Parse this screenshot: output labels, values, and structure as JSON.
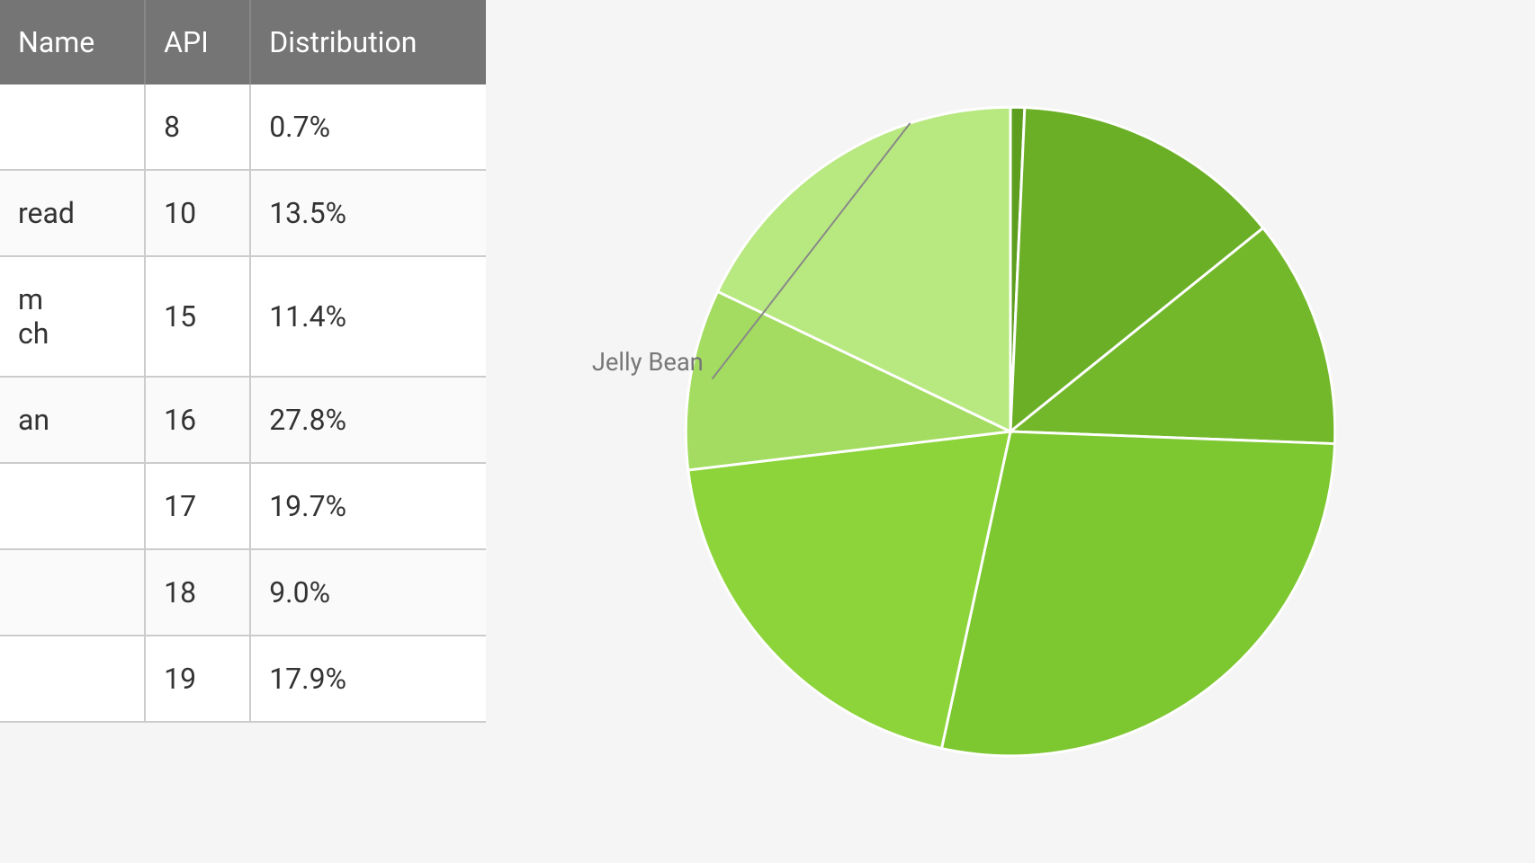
{
  "table": {
    "headers": [
      "Name",
      "API",
      "Distribution"
    ],
    "rows": [
      {
        "name": "",
        "api": "8",
        "distribution": "0.7%"
      },
      {
        "name": "read",
        "api": "10",
        "distribution": "13.5%"
      },
      {
        "name": "m\nch",
        "api": "15",
        "distribution": "11.4%"
      },
      {
        "name": "an",
        "api": "16",
        "distribution": "27.8%"
      },
      {
        "name": "",
        "api": "17",
        "distribution": "19.7%"
      },
      {
        "name": "",
        "api": "18",
        "distribution": "9.0%"
      },
      {
        "name": "",
        "api": "19",
        "distribution": "17.9%"
      }
    ]
  },
  "chart": {
    "label": "Jelly Bean",
    "segments": [
      {
        "name": "api8",
        "value": 0.7,
        "color": "#5d9e1f"
      },
      {
        "name": "api10",
        "value": 13.5,
        "color": "#6aaf25"
      },
      {
        "name": "api15",
        "value": 11.4,
        "color": "#72b82a"
      },
      {
        "name": "api16",
        "value": 27.8,
        "color": "#7dc730"
      },
      {
        "name": "api17",
        "value": 19.7,
        "color": "#8cd43a"
      },
      {
        "name": "api18",
        "value": 9.0,
        "color": "#a3dc60"
      },
      {
        "name": "api19",
        "value": 17.9,
        "color": "#b8e880"
      }
    ]
  }
}
